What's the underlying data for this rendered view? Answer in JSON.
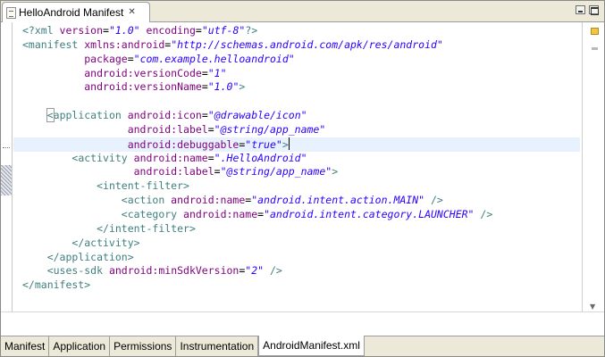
{
  "editor_tab": {
    "title": "HelloAndroid Manifest",
    "close_glyph": "✕"
  },
  "code_lines": [
    [
      {
        "c": "pi",
        "t": "<?xml "
      },
      {
        "c": "attr",
        "t": "version"
      },
      {
        "c": "",
        "t": "="
      },
      {
        "c": "val",
        "t": "\"1.0\""
      },
      {
        "c": "",
        "t": " "
      },
      {
        "c": "attr",
        "t": "encoding"
      },
      {
        "c": "",
        "t": "="
      },
      {
        "c": "val",
        "t": "\"utf-8\""
      },
      {
        "c": "pi",
        "t": "?>"
      }
    ],
    [
      {
        "c": "tag",
        "t": "<manifest "
      },
      {
        "c": "attr",
        "t": "xmlns:android"
      },
      {
        "c": "",
        "t": "="
      },
      {
        "c": "val",
        "t": "\"http://schemas.android.com/apk/res/android\""
      }
    ],
    [
      {
        "c": "",
        "t": "          "
      },
      {
        "c": "attr",
        "t": "package"
      },
      {
        "c": "",
        "t": "="
      },
      {
        "c": "val",
        "t": "\"com.example.helloandroid\""
      }
    ],
    [
      {
        "c": "",
        "t": "          "
      },
      {
        "c": "attr",
        "t": "android:versionCode"
      },
      {
        "c": "",
        "t": "="
      },
      {
        "c": "val",
        "t": "\"1\""
      }
    ],
    [
      {
        "c": "",
        "t": "          "
      },
      {
        "c": "attr",
        "t": "android:versionName"
      },
      {
        "c": "",
        "t": "="
      },
      {
        "c": "val",
        "t": "\"1.0\""
      },
      {
        "c": "tag",
        "t": ">"
      }
    ],
    [],
    [
      {
        "c": "",
        "t": "    "
      },
      {
        "c": "tag bracket-hl",
        "t": "<"
      },
      {
        "c": "tag",
        "t": "application "
      },
      {
        "c": "attr",
        "t": "android:icon"
      },
      {
        "c": "",
        "t": "="
      },
      {
        "c": "val",
        "t": "\"@drawable/icon\""
      }
    ],
    [
      {
        "c": "",
        "t": "                 "
      },
      {
        "c": "attr",
        "t": "android:label"
      },
      {
        "c": "",
        "t": "="
      },
      {
        "c": "val",
        "t": "\"@string/app_name\""
      }
    ],
    [
      {
        "c": "",
        "t": "                 "
      },
      {
        "c": "attr",
        "t": "android:debuggable"
      },
      {
        "c": "",
        "t": "="
      },
      {
        "c": "val",
        "t": "\"true\""
      },
      {
        "c": "tag",
        "t": ">"
      },
      {
        "c": "caret",
        "t": ""
      }
    ],
    [
      {
        "c": "",
        "t": "        "
      },
      {
        "c": "tag",
        "t": "<activity "
      },
      {
        "c": "attr",
        "t": "android:name"
      },
      {
        "c": "",
        "t": "="
      },
      {
        "c": "val",
        "t": "\".HelloAndroid\""
      }
    ],
    [
      {
        "c": "",
        "t": "                  "
      },
      {
        "c": "attr",
        "t": "android:label"
      },
      {
        "c": "",
        "t": "="
      },
      {
        "c": "val",
        "t": "\"@string/app_name\""
      },
      {
        "c": "tag",
        "t": ">"
      }
    ],
    [
      {
        "c": "",
        "t": "            "
      },
      {
        "c": "tag",
        "t": "<intent-filter>"
      }
    ],
    [
      {
        "c": "",
        "t": "                "
      },
      {
        "c": "tag",
        "t": "<action "
      },
      {
        "c": "attr",
        "t": "android:name"
      },
      {
        "c": "",
        "t": "="
      },
      {
        "c": "val",
        "t": "\"android.intent.action.MAIN\""
      },
      {
        "c": "tag",
        "t": " />"
      }
    ],
    [
      {
        "c": "",
        "t": "                "
      },
      {
        "c": "tag",
        "t": "<category "
      },
      {
        "c": "attr",
        "t": "android:name"
      },
      {
        "c": "",
        "t": "="
      },
      {
        "c": "val",
        "t": "\"android.intent.category.LAUNCHER\""
      },
      {
        "c": "tag",
        "t": " />"
      }
    ],
    [
      {
        "c": "",
        "t": "            "
      },
      {
        "c": "tag",
        "t": "</intent-filter>"
      }
    ],
    [
      {
        "c": "",
        "t": "        "
      },
      {
        "c": "tag",
        "t": "</activity>"
      }
    ],
    [
      {
        "c": "",
        "t": "    "
      },
      {
        "c": "tag",
        "t": "</application>"
      }
    ],
    [
      {
        "c": "",
        "t": "    "
      },
      {
        "c": "tag",
        "t": "<uses-sdk "
      },
      {
        "c": "attr",
        "t": "android:minSdkVersion"
      },
      {
        "c": "",
        "t": "="
      },
      {
        "c": "val",
        "t": "\"2\""
      },
      {
        "c": "tag",
        "t": " />"
      }
    ],
    [
      {
        "c": "tag",
        "t": "</manifest>"
      }
    ]
  ],
  "current_line_index": 8,
  "page_tabs": [
    {
      "label": "Manifest",
      "active": false
    },
    {
      "label": "Application",
      "active": false
    },
    {
      "label": "Permissions",
      "active": false
    },
    {
      "label": "Instrumentation",
      "active": false
    },
    {
      "label": "AndroidManifest.xml",
      "active": true
    }
  ],
  "colors": {
    "tag": "#3f7f7f",
    "attribute": "#7f007f",
    "value": "#2a00ff",
    "current_line": "#e8f2fe",
    "chrome": "#ece9d8"
  },
  "icons": {
    "file": "file-icon",
    "minimize": "minimize-icon",
    "maximize": "maximize-icon",
    "overview_warning": "warning-marker-icon",
    "scroll_down": "chevron-down-icon"
  }
}
